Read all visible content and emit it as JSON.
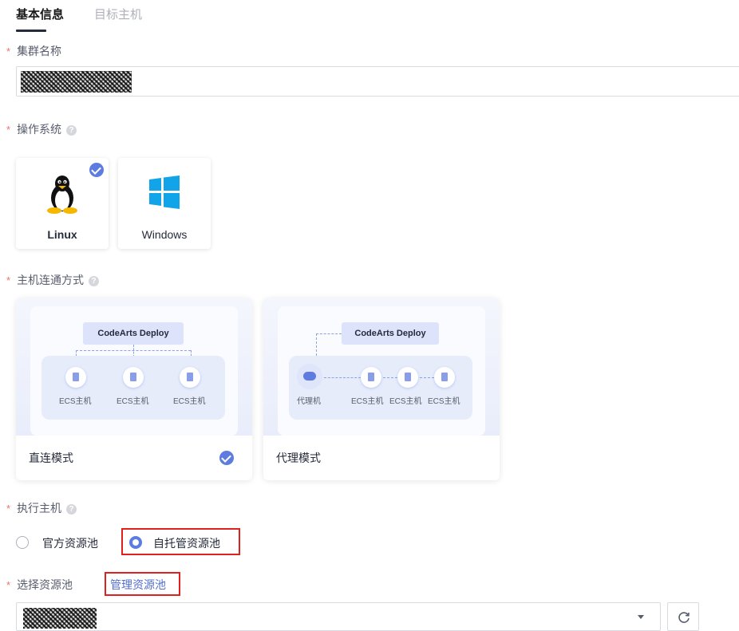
{
  "tabs": [
    {
      "label": "基本信息",
      "active": true
    },
    {
      "label": "目标主机",
      "active": false
    }
  ],
  "fields": {
    "cluster_name": {
      "label": "集群名称",
      "required": true,
      "value_redacted": true
    },
    "os": {
      "label": "操作系统",
      "required": true,
      "help_icon": "question-circle-icon",
      "options": [
        {
          "label": "Linux",
          "icon": "linux-penguin-icon",
          "selected": true
        },
        {
          "label": "Windows",
          "icon": "windows-logo-icon",
          "selected": false
        }
      ]
    },
    "connection": {
      "label": "主机连通方式",
      "required": true,
      "help_icon": "question-circle-icon",
      "options": [
        {
          "title": "直连模式",
          "selected": true,
          "diagram": {
            "top": "CodeArts Deploy",
            "nodes": [
              "ECS主机",
              "ECS主机",
              "ECS主机"
            ]
          }
        },
        {
          "title": "代理模式",
          "selected": false,
          "diagram": {
            "top": "CodeArts Deploy",
            "proxy": "代理机",
            "nodes": [
              "ECS主机",
              "ECS主机",
              "ECS主机"
            ]
          }
        }
      ]
    },
    "exec_host": {
      "label": "执行主机",
      "required": true,
      "help_icon": "question-circle-icon",
      "options": [
        {
          "label": "官方资源池",
          "selected": false
        },
        {
          "label": "自托管资源池",
          "selected": true,
          "highlighted": true
        }
      ]
    },
    "resource_pool": {
      "label": "选择资源池",
      "required": true,
      "manage_link": "管理资源池",
      "value_redacted": true
    }
  },
  "required_mark": "*",
  "help_glyph": "?",
  "colors": {
    "accent": "#5e7ce0",
    "required": "#f66f6a",
    "highlight_border": "#e01f1f",
    "link": "#526ecc"
  }
}
